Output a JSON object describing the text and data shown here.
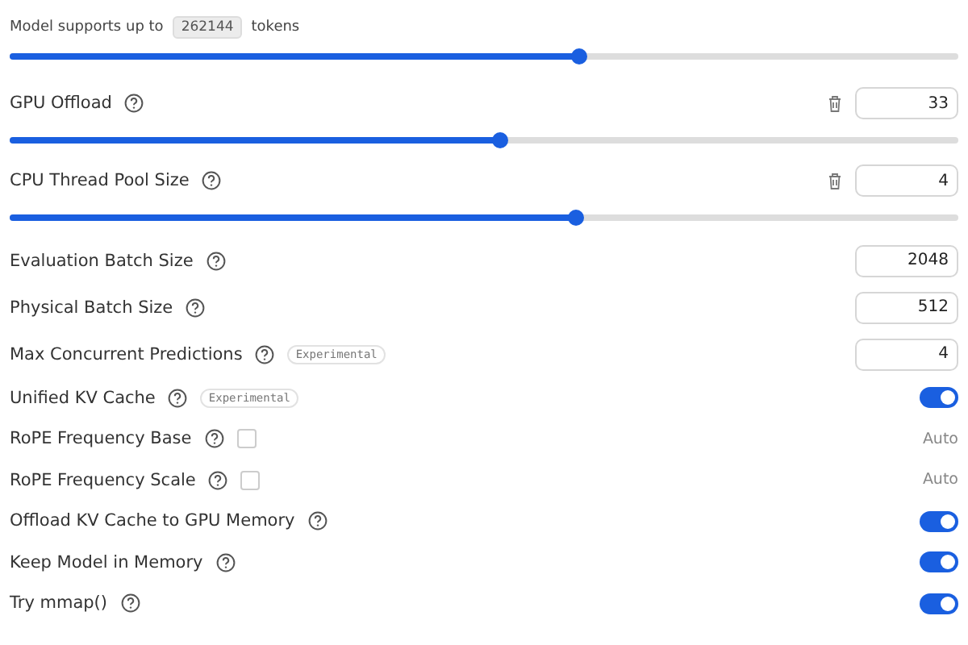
{
  "context_note": {
    "prefix": "Model supports up to",
    "value": "262144",
    "suffix": "tokens",
    "level": 0.6
  },
  "slider_settings": [
    {
      "label": "GPU Offload",
      "value": "33",
      "level": 0.517
    },
    {
      "label": "CPU Thread Pool Size",
      "value": "4",
      "level": 0.597
    }
  ],
  "settings": [
    {
      "kind": "number",
      "label": "Evaluation Batch Size",
      "value": "2048"
    },
    {
      "kind": "number",
      "label": "Physical Batch Size",
      "value": "512"
    },
    {
      "kind": "number",
      "label": "Max Concurrent Predictions",
      "badge": "Experimental",
      "value": "4"
    },
    {
      "kind": "toggle",
      "label": "Unified KV Cache",
      "badge": "Experimental",
      "on": true
    },
    {
      "kind": "auto",
      "label": "RoPE Frequency Base",
      "checked": false,
      "value": "Auto"
    },
    {
      "kind": "auto",
      "label": "RoPE Frequency Scale",
      "checked": false,
      "value": "Auto"
    },
    {
      "kind": "toggle",
      "label": "Offload KV Cache to GPU Memory",
      "on": true
    },
    {
      "kind": "toggle",
      "label": "Keep Model in Memory",
      "on": true
    },
    {
      "kind": "toggle",
      "label": "Try mmap()",
      "on": true
    }
  ]
}
